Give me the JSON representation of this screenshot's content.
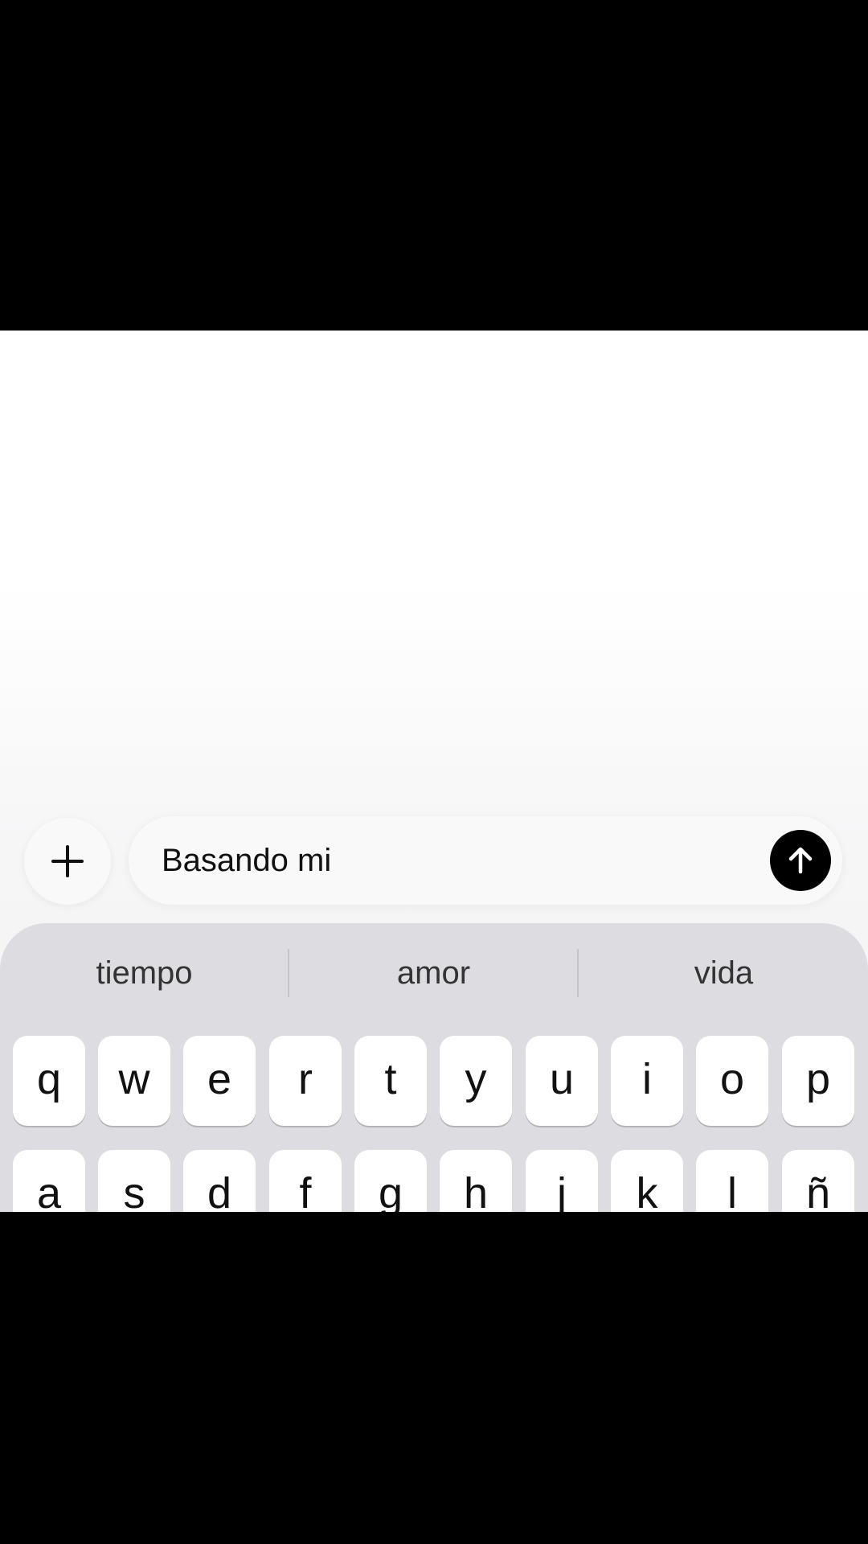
{
  "composer": {
    "input_value": "Basando mi",
    "plus_icon": "plus-icon",
    "send_icon": "arrow-up-icon"
  },
  "keyboard": {
    "suggestions": [
      "tiempo",
      "amor",
      "vida"
    ],
    "rows": [
      [
        "q",
        "w",
        "e",
        "r",
        "t",
        "y",
        "u",
        "i",
        "o",
        "p"
      ],
      [
        "a",
        "s",
        "d",
        "f",
        "g",
        "h",
        "j",
        "k",
        "l",
        "ñ"
      ]
    ]
  },
  "colors": {
    "send_button": "#000000",
    "keyboard_background": "#dcdce1",
    "key_background": "#ffffff"
  }
}
